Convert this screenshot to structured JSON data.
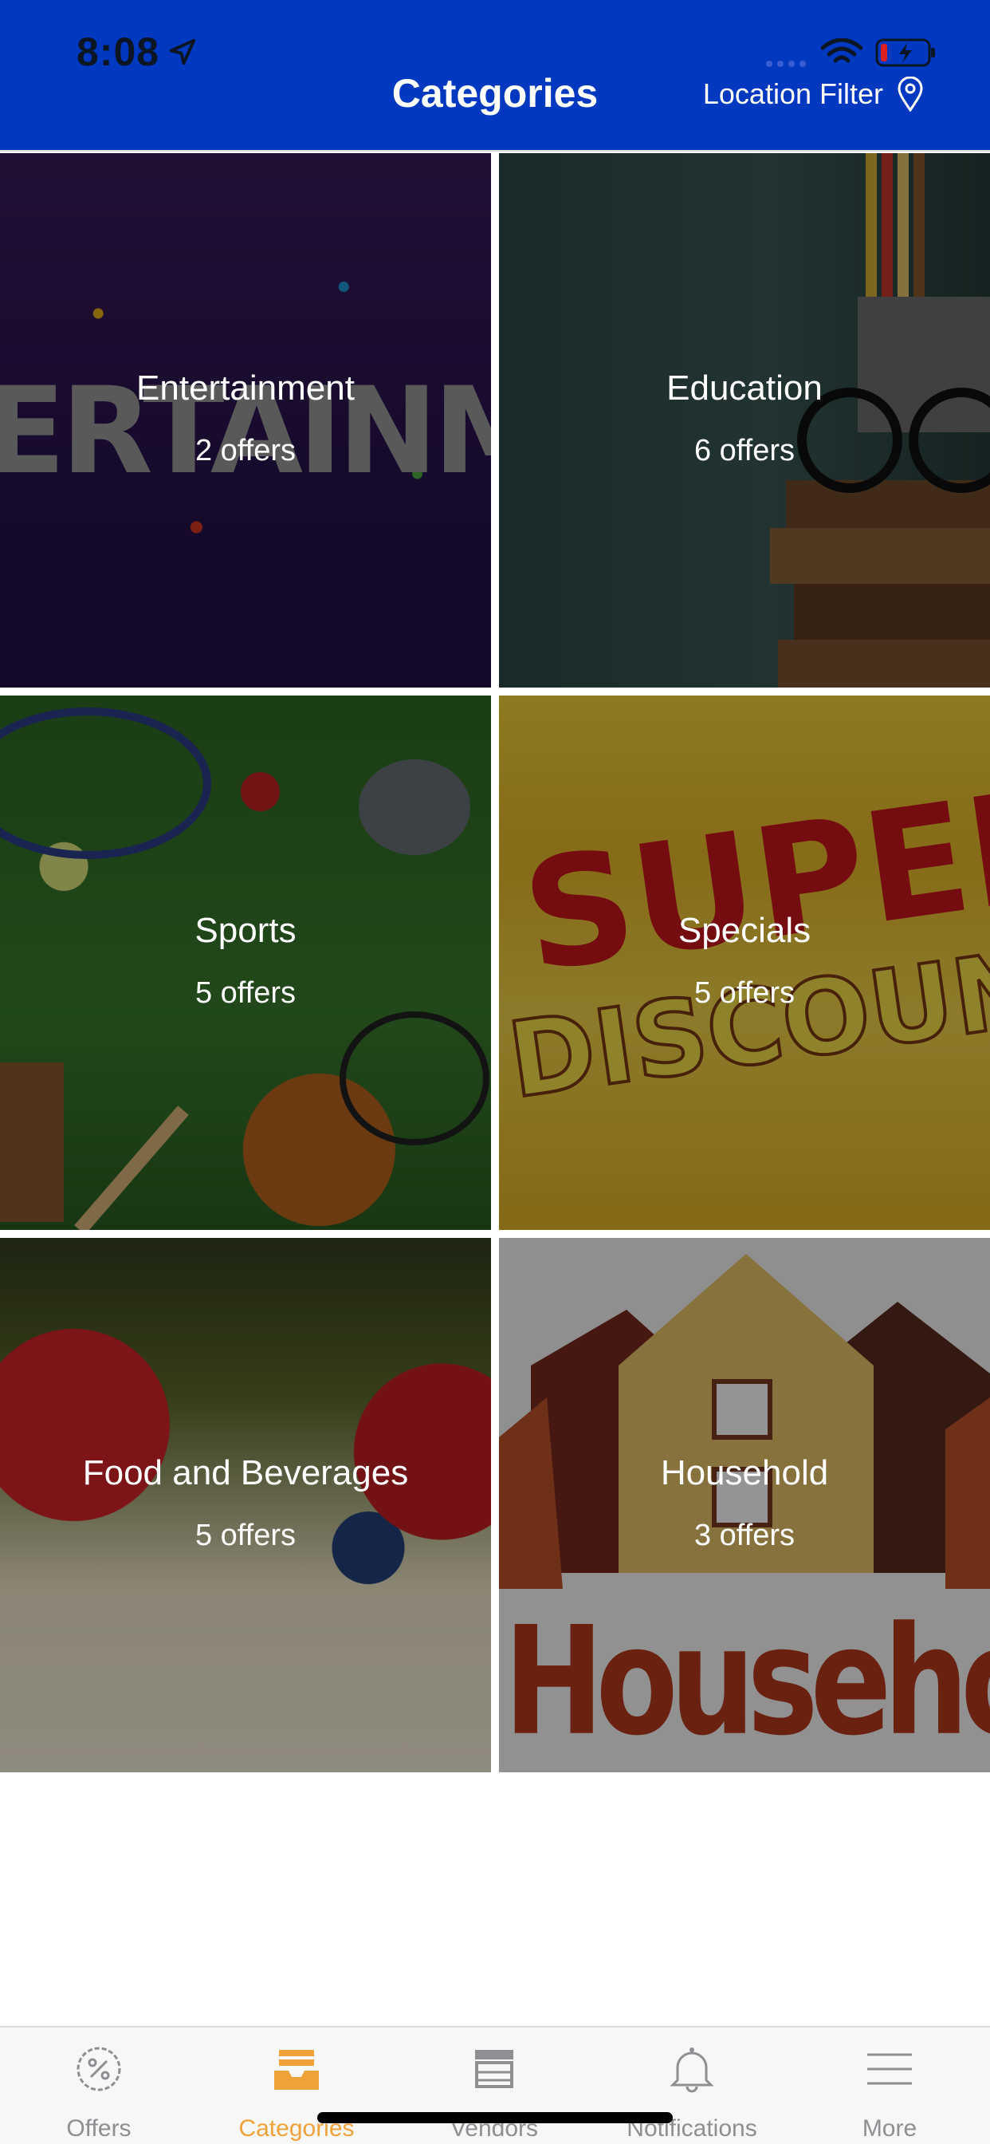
{
  "status_bar": {
    "time": "8:08",
    "icons": [
      "location-arrow-icon",
      "signal-icon",
      "wifi-icon",
      "battery-charging-icon"
    ]
  },
  "header": {
    "title": "Categories",
    "location_filter": "Location Filter",
    "location_icon": "map-pin-icon",
    "background_color": "#0039c0"
  },
  "categories": [
    {
      "name": "Entertainment",
      "count": "2 offers"
    },
    {
      "name": "Education",
      "count": "6 offers"
    },
    {
      "name": "Sports",
      "count": "5 offers"
    },
    {
      "name": "Specials",
      "count": "5 offers"
    },
    {
      "name": "Food and Beverages",
      "count": "5 offers"
    },
    {
      "name": "Household",
      "count": "3 offers"
    }
  ],
  "image_text": {
    "entertainment": "ERTAINM",
    "specials_line1": "SUPER",
    "specials_line2": "DISCOUNT",
    "household": "Household"
  },
  "tab_bar": {
    "active_color": "#f0a23a",
    "inactive_color": "#8e8e93",
    "tabs": [
      {
        "label": "Offers",
        "icon": "percent-badge-icon",
        "active": false
      },
      {
        "label": "Categories",
        "icon": "inbox-tray-icon",
        "active": true
      },
      {
        "label": "Vendors",
        "icon": "storefront-icon",
        "active": false
      },
      {
        "label": "Notifications",
        "icon": "bell-icon",
        "active": false
      },
      {
        "label": "More",
        "icon": "menu-lines-icon",
        "active": false
      }
    ]
  }
}
